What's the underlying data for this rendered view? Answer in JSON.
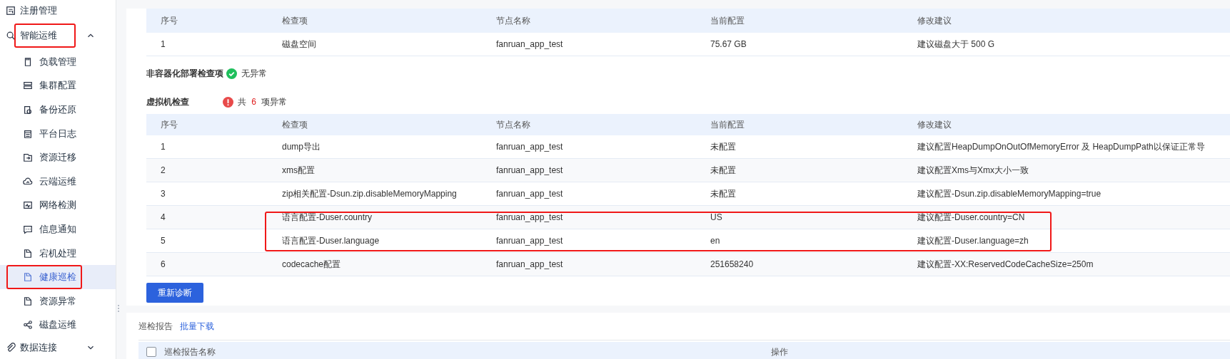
{
  "sidebar": {
    "items": [
      {
        "label": "注册管理",
        "annotated": false
      },
      {
        "label": "智能运维",
        "expanded": true,
        "annotated": true,
        "children": [
          {
            "label": "负载管理",
            "selected": false,
            "annotated": false
          },
          {
            "label": "集群配置",
            "selected": false,
            "annotated": false
          },
          {
            "label": "备份还原",
            "selected": false,
            "annotated": false
          },
          {
            "label": "平台日志",
            "selected": false,
            "annotated": false
          },
          {
            "label": "资源迁移",
            "selected": false,
            "annotated": false
          },
          {
            "label": "云端运维",
            "selected": false,
            "annotated": false
          },
          {
            "label": "网络检测",
            "selected": false,
            "annotated": false
          },
          {
            "label": "信息通知",
            "selected": false,
            "annotated": false
          },
          {
            "label": "宕机处理",
            "selected": false,
            "annotated": false
          },
          {
            "label": "健康巡检",
            "selected": true,
            "annotated": true
          },
          {
            "label": "资源异常",
            "selected": false,
            "annotated": false
          },
          {
            "label": "磁盘运维",
            "selected": false,
            "annotated": false
          }
        ]
      },
      {
        "label": "数据连接",
        "expanded": false,
        "annotated": false
      }
    ]
  },
  "container_check": {
    "columns": [
      "序号",
      "检查项",
      "节点名称",
      "当前配置",
      "修改建议"
    ],
    "rows": [
      {
        "cells": [
          "1",
          "磁盘空间",
          "fanruan_app_test",
          "75.67 GB",
          "建议磁盘大于 500 G"
        ],
        "annotated": false
      }
    ]
  },
  "non_container_check": {
    "title": "非容器化部署检查项",
    "kind": "ok",
    "message": "无异常"
  },
  "vm_check": {
    "title": "虚拟机检查",
    "kind": "error",
    "message_prefix": "共",
    "count": "6",
    "message_suffix": "项异常",
    "columns": [
      "序号",
      "检查项",
      "节点名称",
      "当前配置",
      "修改建议"
    ],
    "rows": [
      {
        "cells": [
          "1",
          "dump导出",
          "fanruan_app_test",
          "未配置",
          "建议配置HeapDumpOnOutOfMemoryError 及 HeapDumpPath以保证正常导"
        ],
        "annotated": false
      },
      {
        "cells": [
          "2",
          "xms配置",
          "fanruan_app_test",
          "未配置",
          "建议配置Xms与Xmx大小一致"
        ],
        "annotated": false
      },
      {
        "cells": [
          "3",
          "zip相关配置-Dsun.zip.disableMemoryMapping",
          "fanruan_app_test",
          "未配置",
          "建议配置-Dsun.zip.disableMemoryMapping=true"
        ],
        "annotated": false
      },
      {
        "cells": [
          "4",
          "语言配置-Duser.country",
          "fanruan_app_test",
          "US",
          "建议配置-Duser.country=CN"
        ],
        "annotated": true
      },
      {
        "cells": [
          "5",
          "语言配置-Duser.language",
          "fanruan_app_test",
          "en",
          "建议配置-Duser.language=zh"
        ],
        "annotated": true
      },
      {
        "cells": [
          "6",
          "codecache配置",
          "fanruan_app_test",
          "251658240",
          "建议配置-XX:ReservedCodeCacheSize=250m"
        ],
        "annotated": false
      }
    ]
  },
  "rediagnose_button": "重新诊断",
  "reports": {
    "title": "巡检报告",
    "link": "批量下载",
    "select_all_checked": false,
    "columns": [
      "巡检报告名称",
      "操作"
    ]
  }
}
